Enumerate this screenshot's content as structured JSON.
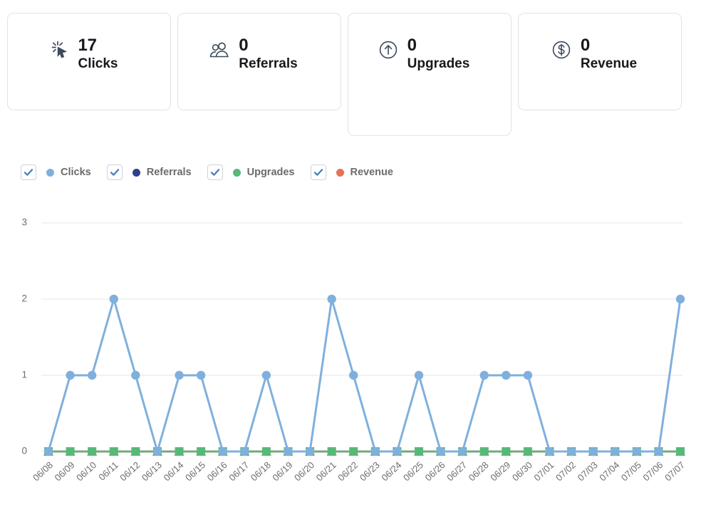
{
  "stats": [
    {
      "icon": "click-cursor-icon",
      "value": "17",
      "label": "Clicks",
      "name": "clicks"
    },
    {
      "icon": "users-icon",
      "value": "0",
      "label": "Referrals",
      "name": "referrals"
    },
    {
      "icon": "arrow-up-circle-icon",
      "value": "0",
      "label": "Upgrades",
      "name": "upgrades"
    },
    {
      "icon": "dollar-circle-icon",
      "value": "0",
      "label": "Revenue",
      "name": "revenue"
    }
  ],
  "legend": {
    "items": [
      {
        "label": "Clicks",
        "color": "#7fb0dd",
        "checked": true,
        "name": "clicks"
      },
      {
        "label": "Referrals",
        "color": "#2f3f8f",
        "checked": true,
        "name": "referrals"
      },
      {
        "label": "Upgrades",
        "color": "#57b878",
        "checked": true,
        "name": "upgrades"
      },
      {
        "label": "Revenue",
        "color": "#e8714f",
        "checked": true,
        "name": "revenue"
      }
    ],
    "checkmark": "✓"
  },
  "chart_data": {
    "type": "line",
    "title": "",
    "xlabel": "",
    "ylabel": "",
    "ylim": [
      0,
      3
    ],
    "yticks": [
      "0",
      "1",
      "2",
      "3"
    ],
    "grid": true,
    "legend_position": "top",
    "categories": [
      "06/08",
      "06/09",
      "06/10",
      "06/11",
      "06/12",
      "06/13",
      "06/14",
      "06/15",
      "06/16",
      "06/17",
      "06/18",
      "06/19",
      "06/20",
      "06/21",
      "06/22",
      "06/23",
      "06/24",
      "06/25",
      "06/26",
      "06/27",
      "06/28",
      "06/29",
      "06/30",
      "07/01",
      "07/02",
      "07/03",
      "07/04",
      "07/05",
      "07/06",
      "07/07"
    ],
    "series": [
      {
        "name": "Clicks",
        "color": "#7fb0dd",
        "marker": "circle",
        "values": [
          0,
          1,
          1,
          2,
          1,
          0,
          1,
          1,
          0,
          0,
          1,
          0,
          0,
          2,
          1,
          0,
          0,
          1,
          0,
          0,
          1,
          1,
          1,
          0,
          0,
          0,
          0,
          0,
          0,
          2
        ]
      },
      {
        "name": "Referrals",
        "color": "#2f3f8f",
        "marker": "none",
        "values": [
          0,
          0,
          0,
          0,
          0,
          0,
          0,
          0,
          0,
          0,
          0,
          0,
          0,
          0,
          0,
          0,
          0,
          0,
          0,
          0,
          0,
          0,
          0,
          0,
          0,
          0,
          0,
          0,
          0,
          0
        ]
      },
      {
        "name": "Upgrades",
        "color": "#57b878",
        "marker": "square",
        "values": [
          0,
          0,
          0,
          0,
          0,
          0,
          0,
          0,
          0,
          0,
          0,
          0,
          0,
          0,
          0,
          0,
          0,
          0,
          0,
          0,
          0,
          0,
          0,
          0,
          0,
          0,
          0,
          0,
          0,
          0
        ]
      },
      {
        "name": "Revenue",
        "color": "#e8714f",
        "marker": "triangle",
        "values": [
          0,
          0,
          0,
          0,
          0,
          0,
          0,
          0,
          0,
          0,
          0,
          0,
          0,
          0,
          0,
          0,
          0,
          0,
          0,
          0,
          0,
          0,
          0,
          0,
          0,
          0,
          0,
          0,
          0,
          0
        ]
      }
    ]
  }
}
